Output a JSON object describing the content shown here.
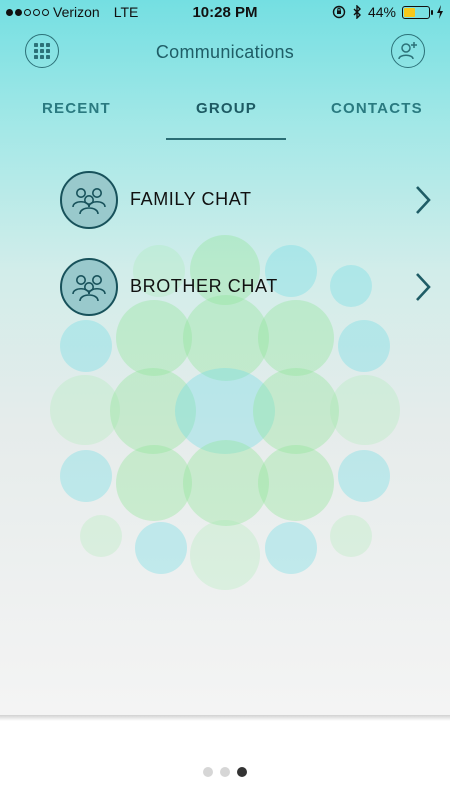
{
  "status_bar": {
    "carrier": "Verizon",
    "network": "LTE",
    "time": "10:28 PM",
    "battery": "44%",
    "battery_level": 0.44,
    "battery_color": "#f7c81a"
  },
  "header": {
    "title": "Communications",
    "left_icon": "grid-menu-icon",
    "right_icon": "add-contact-icon"
  },
  "tabs": [
    {
      "label": "RECENT",
      "active": false
    },
    {
      "label": "GROUP",
      "active": true
    },
    {
      "label": "CONTACTS",
      "active": false
    }
  ],
  "groups": [
    {
      "label": "FAMILY CHAT",
      "icon": "group-people-icon"
    },
    {
      "label": "BROTHER CHAT",
      "icon": "group-people-icon"
    }
  ],
  "pager": {
    "pages": 3,
    "active": 3
  },
  "colors": {
    "accent": "#1f5d66",
    "gradient_top": "#74dfe2",
    "avatar_fill": "#99c9cc"
  }
}
